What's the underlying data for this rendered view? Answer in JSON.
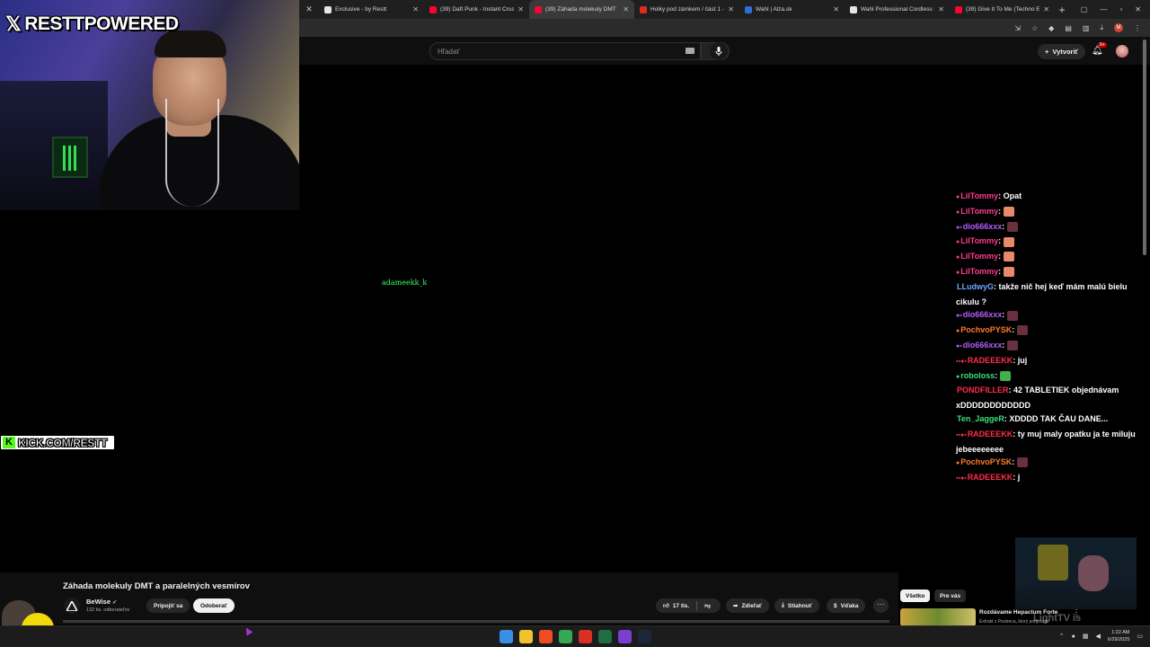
{
  "webcam": {
    "brand_text": "RESTTPOWERED",
    "kick_text": "KICK.COM/RESTT"
  },
  "floating_username": "adameekk_k",
  "browser": {
    "tabs": [
      {
        "label": "Exclusive - by Restt",
        "favicon_color": "#e6e6e6",
        "active": false
      },
      {
        "label": "(39) Daft Punk - Instant Crush",
        "favicon_color": "#ff0033",
        "active": false
      },
      {
        "label": "(39) Záhada molekuly DMT",
        "favicon_color": "#ff0033",
        "active": true
      },
      {
        "label": "Holky pod zámkem / část 1 -",
        "favicon_color": "#e02b20",
        "active": false
      },
      {
        "label": "Wahl | Alza.sk",
        "favicon_color": "#2f6fd8",
        "active": false
      },
      {
        "label": "Wahl Professional Cordless D",
        "favicon_color": "#e6e6e6",
        "active": false
      },
      {
        "label": "(39) Give It To Me (Techno Ed",
        "favicon_color": "#ff0033",
        "active": false
      }
    ]
  },
  "youtube": {
    "search_placeholder": "Hľadať",
    "create_label": "Vytvoriť",
    "notif_badge": "9+",
    "video_title": "Záhada molekuly DMT a paralelných vesmírov",
    "channel_name": "BeWise",
    "channel_subs": "132 tis. odberateľov",
    "join_label": "Pripojiť sa",
    "subscribe_label": "Odoberať",
    "like_count": "17 tis.",
    "share_label": "Zdieľať",
    "download_label": "Stiahnuť",
    "thanks_label": "Vďaka",
    "chip_all": "Všetko",
    "chip_for_you": "Pre vás",
    "rec_title": "Rozdávame Hepactum Forte",
    "rec_sub": "Extrakt z Pestreca, ktorý podporuje",
    "watermark": "LightTV is"
  },
  "chat": [
    {
      "badges": "●",
      "user": "LilTommy",
      "color": "#ff3d8b",
      "text": "Opat",
      "emote": false
    },
    {
      "badges": "●",
      "user": "LilTommy",
      "color": "#ff3d8b",
      "text": "",
      "emote": true,
      "emote_color": "#e88a6a"
    },
    {
      "badges": "●▪",
      "user": "dio666xxx",
      "color": "#b65cff",
      "text": "",
      "emote": true,
      "emote_color": "#6a3040"
    },
    {
      "badges": "●",
      "user": "LilTommy",
      "color": "#ff3d8b",
      "text": "",
      "emote": true,
      "emote_color": "#e88a6a"
    },
    {
      "badges": "●",
      "user": "LilTommy",
      "color": "#ff3d8b",
      "text": "",
      "emote": true,
      "emote_color": "#e88a6a"
    },
    {
      "badges": "●",
      "user": "LilTommy",
      "color": "#ff3d8b",
      "text": "",
      "emote": true,
      "emote_color": "#e88a6a"
    },
    {
      "badges": "",
      "user": "LLudwyG",
      "color": "#6aa8ff",
      "text": "takže nič hej keď mám malú bielu cikulu ?",
      "emote": false
    },
    {
      "badges": "●▪",
      "user": "dio666xxx",
      "color": "#b65cff",
      "text": "",
      "emote": true,
      "emote_color": "#6a3040"
    },
    {
      "badges": "●",
      "user": "PochvoPYSK",
      "color": "#ff7a2a",
      "text": "",
      "emote": true,
      "emote_color": "#6a3040"
    },
    {
      "badges": "●▪",
      "user": "dio666xxx",
      "color": "#b65cff",
      "text": "",
      "emote": true,
      "emote_color": "#6a3040"
    },
    {
      "badges": "▪▪●▪",
      "user": "RADEEEKK",
      "color": "#ff2d4a",
      "text": "juj",
      "emote": false
    },
    {
      "badges": "●",
      "user": "roboloss",
      "color": "#3ce07a",
      "text": "",
      "emote": true,
      "emote_color": "#3fb04a"
    },
    {
      "badges": "",
      "user": "PONDFILLER",
      "color": "#ff2d4a",
      "text": "42 TABLETIEK objednávam xDDDDDDDDDDDD",
      "emote": false
    },
    {
      "badges": "",
      "user": "Ten_JaggeR",
      "color": "#3ce07a",
      "text": "XDDDD TAK ČAU DANE...",
      "emote": false
    },
    {
      "badges": "▪▪●▪",
      "user": "RADEEEKK",
      "color": "#ff2d4a",
      "text": "ty muj maly opatku ja te miluju jebeeeeeeee",
      "emote": false
    },
    {
      "badges": "●",
      "user": "PochvoPYSK",
      "color": "#ff7a2a",
      "text": "",
      "emote": true,
      "emote_color": "#6a3040"
    },
    {
      "badges": "▪▪●▪",
      "user": "RADEEEKK",
      "color": "#ff2d4a",
      "text": "j",
      "emote": false
    }
  ],
  "taskbar": {
    "time": "1:22 AM",
    "date": "6/29/2025",
    "icons": [
      {
        "name": "start-icon",
        "color": "#3a8ee6"
      },
      {
        "name": "file-explorer-icon",
        "color": "#f2c12e"
      },
      {
        "name": "brave-icon",
        "color": "#f04b23"
      },
      {
        "name": "chrome-icon",
        "color": "#34a853"
      },
      {
        "name": "chrome-red-icon",
        "color": "#d93025"
      },
      {
        "name": "excel-icon",
        "color": "#1d6f42"
      },
      {
        "name": "obs-icon",
        "color": "#7a3fd1"
      },
      {
        "name": "steam-icon",
        "color": "#1b2838"
      }
    ]
  }
}
